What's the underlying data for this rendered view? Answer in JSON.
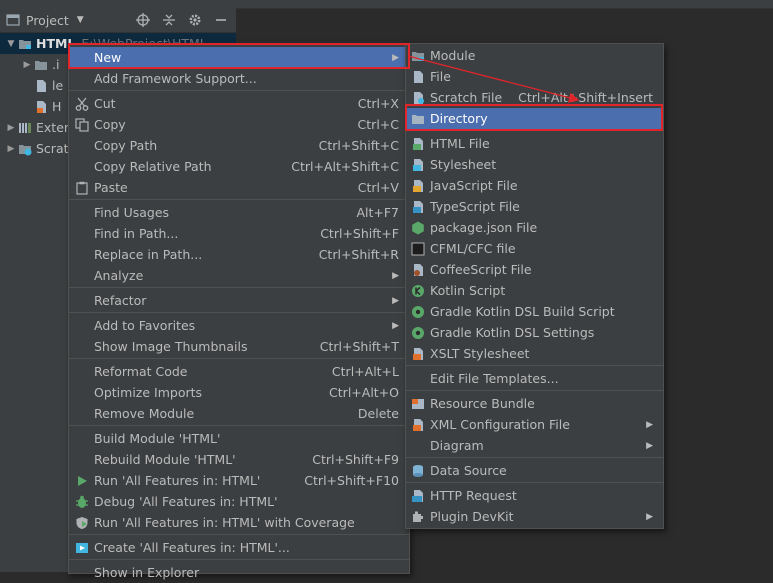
{
  "panel": {
    "title": "Project",
    "tree": [
      {
        "label": "HTML",
        "path": "E:\\WebProject\\HTML",
        "expanded": true
      },
      {
        "label": ".i"
      },
      {
        "label": "le"
      },
      {
        "label": "H"
      },
      {
        "label": "Exter"
      },
      {
        "label": "Scrat"
      }
    ]
  },
  "context_menu": {
    "new": "New",
    "add_framework": "Add Framework Support...",
    "cut": "Cut",
    "cut_sc": "Ctrl+X",
    "copy": "Copy",
    "copy_sc": "Ctrl+C",
    "copy_path": "Copy Path",
    "copy_path_sc": "Ctrl+Shift+C",
    "copy_relative_path": "Copy Relative Path",
    "copy_relative_path_sc": "Ctrl+Alt+Shift+C",
    "paste": "Paste",
    "paste_sc": "Ctrl+V",
    "find_usages": "Find Usages",
    "find_usages_sc": "Alt+F7",
    "find_in_path": "Find in Path...",
    "find_in_path_sc": "Ctrl+Shift+F",
    "replace_in_path": "Replace in Path...",
    "replace_in_path_sc": "Ctrl+Shift+R",
    "analyze": "Analyze",
    "refactor": "Refactor",
    "add_to_favorites": "Add to Favorites",
    "show_image_thumbnails": "Show Image Thumbnails",
    "show_image_thumbnails_sc": "Ctrl+Shift+T",
    "reformat_code": "Reformat Code",
    "reformat_code_sc": "Ctrl+Alt+L",
    "optimize_imports": "Optimize Imports",
    "optimize_imports_sc": "Ctrl+Alt+O",
    "remove_module": "Remove Module",
    "remove_module_sc": "Delete",
    "build_module": "Build Module 'HTML'",
    "rebuild_module": "Rebuild Module 'HTML'",
    "rebuild_module_sc": "Ctrl+Shift+F9",
    "run_all": "Run 'All Features in: HTML'",
    "run_all_sc": "Ctrl+Shift+F10",
    "debug_all": "Debug 'All Features in: HTML'",
    "run_coverage": "Run 'All Features in: HTML' with Coverage",
    "create_all": "Create 'All Features in: HTML'...",
    "show_in_explorer": "Show in Explorer"
  },
  "new_submenu": {
    "module": "Module",
    "file": "File",
    "scratch_file": "Scratch File",
    "scratch_file_sc": "Ctrl+Alt+Shift+Insert",
    "directory": "Directory",
    "html_file": "HTML File",
    "stylesheet": "Stylesheet",
    "javascript_file": "JavaScript File",
    "typescript_file": "TypeScript File",
    "package_json": "package.json File",
    "cfml": "CFML/CFC file",
    "coffeescript": "CoffeeScript File",
    "kotlin_script": "Kotlin Script",
    "gradle_build": "Gradle Kotlin DSL Build Script",
    "gradle_settings": "Gradle Kotlin DSL Settings",
    "xslt": "XSLT Stylesheet",
    "edit_templates": "Edit File Templates...",
    "resource_bundle": "Resource Bundle",
    "xml_config": "XML Configuration File",
    "diagram": "Diagram",
    "data_source": "Data Source",
    "http_request": "HTTP Request",
    "plugin_devkit": "Plugin DevKit"
  },
  "colors": {
    "highlight": "#4b6eaf",
    "annotation": "#e0252b",
    "background": "#3c3f41"
  }
}
